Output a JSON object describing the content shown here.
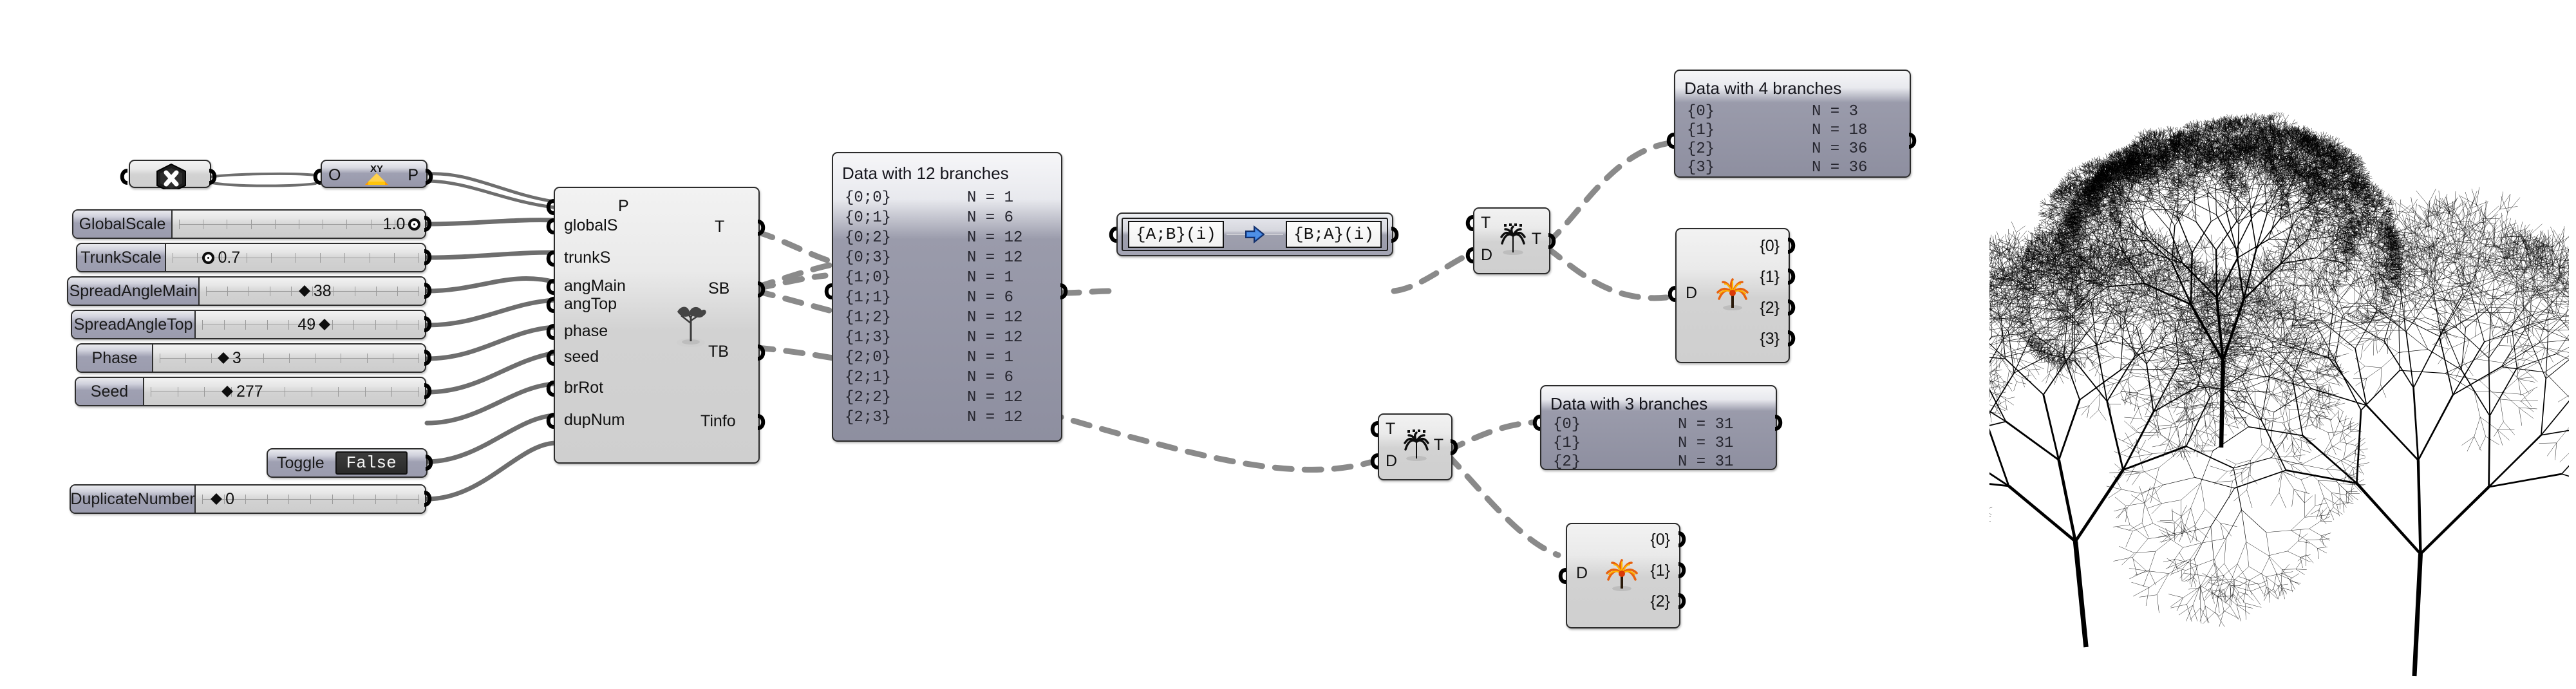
{
  "app": {
    "name": "Grasshopper Canvas",
    "background": "#ffffff"
  },
  "palette": {
    "node_border": "#2b2b2b",
    "node_fill_top": "#f2f2f2",
    "node_fill_bottom": "#cfcfcf",
    "panel_fill": "#9a9bab",
    "param_header": "#9fa0b2",
    "wire_color": "#6e6e6e",
    "toggle_text": "#f4f4f4",
    "toggle_bg": "#2f2f2f",
    "tree_ink": "#000000",
    "palm_icon_orange": "#f0920c",
    "xy_icon_orange": "#ffb400"
  },
  "nodes": {
    "point_param": {
      "name": "point-param",
      "icon": "x-hexagon-icon"
    },
    "xy_plane": {
      "name": "xy-plane",
      "input": "O",
      "output": "P",
      "icon": "xy-plane-icon"
    },
    "tree_component": {
      "name": "tree-generator",
      "icon": "tree-sapling-icon",
      "inputs": [
        "P",
        "globalS",
        "trunkS",
        "angMain",
        "angTop",
        "phase",
        "seed",
        "brRot",
        "dupNum"
      ],
      "outputs": [
        "T",
        "SB",
        "TB",
        "Tinfo"
      ]
    },
    "path_mapper": {
      "name": "path-mapper",
      "source": "{A;B}(i)",
      "target": "{B;A}(i)",
      "icon": "blue-arrow-right-icon"
    },
    "tree_branch_top": {
      "name": "tree-branch-top",
      "icon": "palm-black-icon",
      "inputs": [
        "T",
        "D"
      ],
      "outputs": [
        "T"
      ]
    },
    "tree_branch_bottom": {
      "name": "tree-branch-bottom",
      "icon": "palm-black-icon",
      "inputs": [
        "T",
        "D"
      ],
      "outputs": [
        "T"
      ]
    },
    "explode_tree_top": {
      "name": "explode-tree-top",
      "icon": "palm-orange-icon",
      "inputs": [
        "D"
      ],
      "outputs": [
        "{0}",
        "{1}",
        "{2}",
        "{3}"
      ]
    },
    "explode_tree_bottom": {
      "name": "explode-tree-bottom",
      "icon": "palm-orange-icon",
      "inputs": [
        "D"
      ],
      "outputs": [
        "{0}",
        "{1}",
        "{2}"
      ]
    }
  },
  "sliders": [
    {
      "name": "global-scale-slider",
      "label": "GlobalScale",
      "value": "1.0",
      "knob": "circle",
      "pos_pct": 97,
      "ticks": 11,
      "value_side": "left"
    },
    {
      "name": "trunk-scale-slider",
      "label": "TrunkScale",
      "value": "0.7",
      "knob": "circle",
      "pos_pct": 13,
      "ticks": 11,
      "value_side": "right"
    },
    {
      "name": "spread-angle-main-slider",
      "label": "SpreadAngleMain",
      "value": "38",
      "knob": "diamond",
      "pos_pct": 44,
      "ticks": 11,
      "value_side": "right"
    },
    {
      "name": "spread-angle-top-slider",
      "label": "SpreadAngleTop",
      "value": "49",
      "knob": "diamond",
      "pos_pct": 58,
      "ticks": 11,
      "value_side": "left"
    },
    {
      "name": "phase-slider",
      "label": "Phase",
      "value": "3",
      "knob": "diamond",
      "pos_pct": 23,
      "ticks": 11,
      "value_side": "right"
    },
    {
      "name": "seed-slider",
      "label": "Seed",
      "value": "277",
      "knob": "diamond",
      "pos_pct": 27,
      "ticks": 11,
      "value_side": "right"
    },
    {
      "name": "duplicate-number-slider",
      "label": "DuplicateNumber",
      "value": "0",
      "knob": "diamond",
      "pos_pct": 5,
      "ticks": 11,
      "value_side": "right"
    }
  ],
  "toggle": {
    "name": "toggle",
    "label": "Toggle",
    "value": "False"
  },
  "panels": [
    {
      "name": "panel-12-branches",
      "title": "Data with 12 branches",
      "rows": [
        {
          "path": "{0;0}",
          "count": "N = 1"
        },
        {
          "path": "{0;1}",
          "count": "N = 6"
        },
        {
          "path": "{0;2}",
          "count": "N = 12"
        },
        {
          "path": "{0;3}",
          "count": "N = 12"
        },
        {
          "path": "{1;0}",
          "count": "N = 1"
        },
        {
          "path": "{1;1}",
          "count": "N = 6"
        },
        {
          "path": "{1;2}",
          "count": "N = 12"
        },
        {
          "path": "{1;3}",
          "count": "N = 12"
        },
        {
          "path": "{2;0}",
          "count": "N = 1"
        },
        {
          "path": "{2;1}",
          "count": "N = 6"
        },
        {
          "path": "{2;2}",
          "count": "N = 12"
        },
        {
          "path": "{2;3}",
          "count": "N = 12"
        }
      ]
    },
    {
      "name": "panel-4-branches",
      "title": "Data with 4 branches",
      "rows": [
        {
          "path": "{0}",
          "count": "N = 3"
        },
        {
          "path": "{1}",
          "count": "N = 18"
        },
        {
          "path": "{2}",
          "count": "N = 36"
        },
        {
          "path": "{3}",
          "count": "N = 36"
        }
      ]
    },
    {
      "name": "panel-3-branches",
      "title": "Data with 3 branches",
      "rows": [
        {
          "path": "{0}",
          "count": "N = 31"
        },
        {
          "path": "{1}",
          "count": "N = 31"
        },
        {
          "path": "{2}",
          "count": "N = 31"
        }
      ]
    }
  ],
  "viewport": {
    "name": "tree-preview",
    "trees": [
      {
        "name": "tree-dense-top",
        "seed": 7,
        "depth": 9,
        "spread": 38
      },
      {
        "name": "tree-medium-left",
        "seed": 19,
        "depth": 8,
        "spread": 49
      },
      {
        "name": "tree-sparse-right",
        "seed": 31,
        "depth": 7,
        "spread": 45
      }
    ]
  }
}
